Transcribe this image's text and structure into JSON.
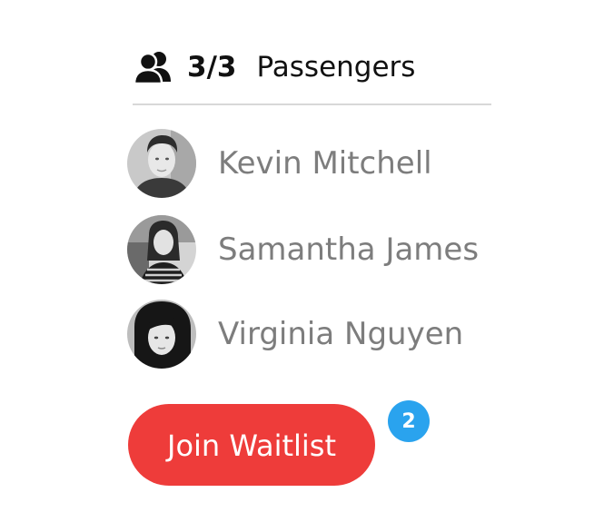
{
  "header": {
    "icon": "people-icon",
    "count": "3/3",
    "label": "Passengers"
  },
  "passengers": [
    {
      "name": "Kevin Mitchell"
    },
    {
      "name": "Samantha James"
    },
    {
      "name": "Virginia Nguyen"
    }
  ],
  "waitlist": {
    "button_label": "Join Waitlist",
    "badge_count": "2"
  },
  "colors": {
    "button": "#ee3c3a",
    "badge": "#2aa3ee",
    "name_text": "#7d7d7d",
    "divider": "#d8d8d8"
  }
}
